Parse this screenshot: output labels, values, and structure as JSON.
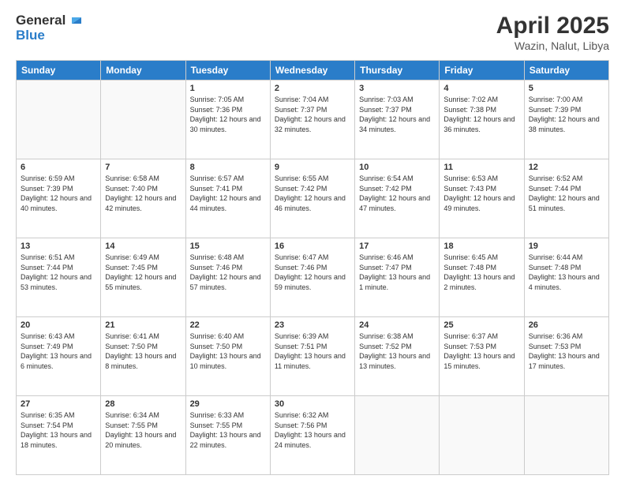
{
  "logo": {
    "line1": "General",
    "line2": "Blue"
  },
  "title": "April 2025",
  "subtitle": "Wazin, Nalut, Libya",
  "days": [
    "Sunday",
    "Monday",
    "Tuesday",
    "Wednesday",
    "Thursday",
    "Friday",
    "Saturday"
  ],
  "weeks": [
    [
      null,
      null,
      {
        "day": "1",
        "sunrise": "Sunrise: 7:05 AM",
        "sunset": "Sunset: 7:36 PM",
        "daylight": "Daylight: 12 hours and 30 minutes."
      },
      {
        "day": "2",
        "sunrise": "Sunrise: 7:04 AM",
        "sunset": "Sunset: 7:37 PM",
        "daylight": "Daylight: 12 hours and 32 minutes."
      },
      {
        "day": "3",
        "sunrise": "Sunrise: 7:03 AM",
        "sunset": "Sunset: 7:37 PM",
        "daylight": "Daylight: 12 hours and 34 minutes."
      },
      {
        "day": "4",
        "sunrise": "Sunrise: 7:02 AM",
        "sunset": "Sunset: 7:38 PM",
        "daylight": "Daylight: 12 hours and 36 minutes."
      },
      {
        "day": "5",
        "sunrise": "Sunrise: 7:00 AM",
        "sunset": "Sunset: 7:39 PM",
        "daylight": "Daylight: 12 hours and 38 minutes."
      }
    ],
    [
      {
        "day": "6",
        "sunrise": "Sunrise: 6:59 AM",
        "sunset": "Sunset: 7:39 PM",
        "daylight": "Daylight: 12 hours and 40 minutes."
      },
      {
        "day": "7",
        "sunrise": "Sunrise: 6:58 AM",
        "sunset": "Sunset: 7:40 PM",
        "daylight": "Daylight: 12 hours and 42 minutes."
      },
      {
        "day": "8",
        "sunrise": "Sunrise: 6:57 AM",
        "sunset": "Sunset: 7:41 PM",
        "daylight": "Daylight: 12 hours and 44 minutes."
      },
      {
        "day": "9",
        "sunrise": "Sunrise: 6:55 AM",
        "sunset": "Sunset: 7:42 PM",
        "daylight": "Daylight: 12 hours and 46 minutes."
      },
      {
        "day": "10",
        "sunrise": "Sunrise: 6:54 AM",
        "sunset": "Sunset: 7:42 PM",
        "daylight": "Daylight: 12 hours and 47 minutes."
      },
      {
        "day": "11",
        "sunrise": "Sunrise: 6:53 AM",
        "sunset": "Sunset: 7:43 PM",
        "daylight": "Daylight: 12 hours and 49 minutes."
      },
      {
        "day": "12",
        "sunrise": "Sunrise: 6:52 AM",
        "sunset": "Sunset: 7:44 PM",
        "daylight": "Daylight: 12 hours and 51 minutes."
      }
    ],
    [
      {
        "day": "13",
        "sunrise": "Sunrise: 6:51 AM",
        "sunset": "Sunset: 7:44 PM",
        "daylight": "Daylight: 12 hours and 53 minutes."
      },
      {
        "day": "14",
        "sunrise": "Sunrise: 6:49 AM",
        "sunset": "Sunset: 7:45 PM",
        "daylight": "Daylight: 12 hours and 55 minutes."
      },
      {
        "day": "15",
        "sunrise": "Sunrise: 6:48 AM",
        "sunset": "Sunset: 7:46 PM",
        "daylight": "Daylight: 12 hours and 57 minutes."
      },
      {
        "day": "16",
        "sunrise": "Sunrise: 6:47 AM",
        "sunset": "Sunset: 7:46 PM",
        "daylight": "Daylight: 12 hours and 59 minutes."
      },
      {
        "day": "17",
        "sunrise": "Sunrise: 6:46 AM",
        "sunset": "Sunset: 7:47 PM",
        "daylight": "Daylight: 13 hours and 1 minute."
      },
      {
        "day": "18",
        "sunrise": "Sunrise: 6:45 AM",
        "sunset": "Sunset: 7:48 PM",
        "daylight": "Daylight: 13 hours and 2 minutes."
      },
      {
        "day": "19",
        "sunrise": "Sunrise: 6:44 AM",
        "sunset": "Sunset: 7:48 PM",
        "daylight": "Daylight: 13 hours and 4 minutes."
      }
    ],
    [
      {
        "day": "20",
        "sunrise": "Sunrise: 6:43 AM",
        "sunset": "Sunset: 7:49 PM",
        "daylight": "Daylight: 13 hours and 6 minutes."
      },
      {
        "day": "21",
        "sunrise": "Sunrise: 6:41 AM",
        "sunset": "Sunset: 7:50 PM",
        "daylight": "Daylight: 13 hours and 8 minutes."
      },
      {
        "day": "22",
        "sunrise": "Sunrise: 6:40 AM",
        "sunset": "Sunset: 7:50 PM",
        "daylight": "Daylight: 13 hours and 10 minutes."
      },
      {
        "day": "23",
        "sunrise": "Sunrise: 6:39 AM",
        "sunset": "Sunset: 7:51 PM",
        "daylight": "Daylight: 13 hours and 11 minutes."
      },
      {
        "day": "24",
        "sunrise": "Sunrise: 6:38 AM",
        "sunset": "Sunset: 7:52 PM",
        "daylight": "Daylight: 13 hours and 13 minutes."
      },
      {
        "day": "25",
        "sunrise": "Sunrise: 6:37 AM",
        "sunset": "Sunset: 7:53 PM",
        "daylight": "Daylight: 13 hours and 15 minutes."
      },
      {
        "day": "26",
        "sunrise": "Sunrise: 6:36 AM",
        "sunset": "Sunset: 7:53 PM",
        "daylight": "Daylight: 13 hours and 17 minutes."
      }
    ],
    [
      {
        "day": "27",
        "sunrise": "Sunrise: 6:35 AM",
        "sunset": "Sunset: 7:54 PM",
        "daylight": "Daylight: 13 hours and 18 minutes."
      },
      {
        "day": "28",
        "sunrise": "Sunrise: 6:34 AM",
        "sunset": "Sunset: 7:55 PM",
        "daylight": "Daylight: 13 hours and 20 minutes."
      },
      {
        "day": "29",
        "sunrise": "Sunrise: 6:33 AM",
        "sunset": "Sunset: 7:55 PM",
        "daylight": "Daylight: 13 hours and 22 minutes."
      },
      {
        "day": "30",
        "sunrise": "Sunrise: 6:32 AM",
        "sunset": "Sunset: 7:56 PM",
        "daylight": "Daylight: 13 hours and 24 minutes."
      },
      null,
      null,
      null
    ]
  ]
}
